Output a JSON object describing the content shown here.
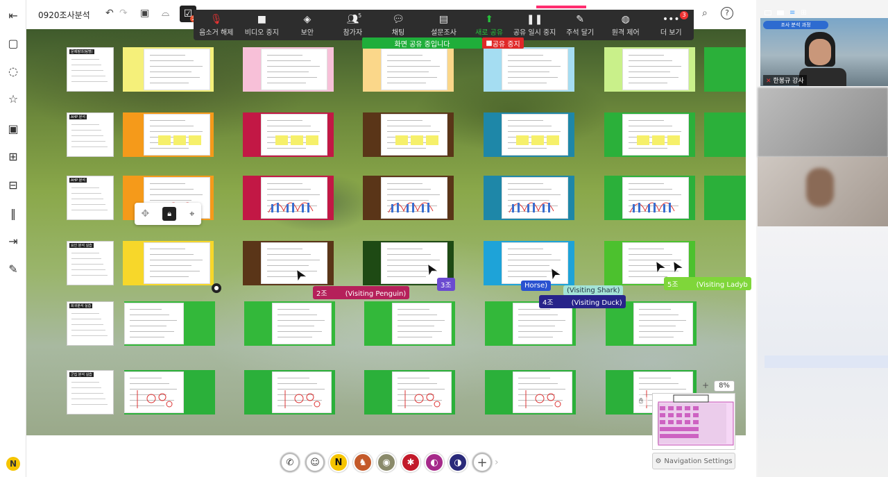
{
  "board": {
    "title": "0920조사분석",
    "badge": "2"
  },
  "zoom_toolbar": {
    "items": [
      {
        "label": "음소거 해제",
        "icon": "mic-off-icon"
      },
      {
        "label": "비디오 중지",
        "icon": "video-icon"
      },
      {
        "label": "보안",
        "icon": "shield-icon"
      },
      {
        "label": "참가자",
        "icon": "participants-icon",
        "count": "5"
      },
      {
        "label": "채팅",
        "icon": "chat-icon"
      },
      {
        "label": "설문조사",
        "icon": "poll-icon"
      },
      {
        "label": "새로 공유",
        "icon": "share-icon"
      },
      {
        "label": "공유 일시 중지",
        "icon": "pause-icon"
      },
      {
        "label": "주석 달기",
        "icon": "pen-icon"
      },
      {
        "label": "원격 제어",
        "icon": "mouse-icon"
      },
      {
        "label": "더 보기",
        "icon": "more-icon",
        "badge": "3"
      }
    ],
    "sharing_banner": "화면 공유 중입니다",
    "stop_share": "공유 중지"
  },
  "row_labels": [
    "문제정의(팀명)",
    "AHP 분석",
    "AHP 분석",
    "요인 분석 실습",
    "회귀분석 실습",
    "군집 분석 실습"
  ],
  "cursors": [
    {
      "label": "2조",
      "suffix": "(Visiting Penguin)",
      "color": "#b5205a"
    },
    {
      "label": "3조",
      "suffix": "",
      "color": "#6b4bd0"
    },
    {
      "label": "Horse)",
      "suffix": "",
      "color": "#2a52d0"
    },
    {
      "label": "(Visiting Shark)",
      "suffix": "",
      "color": "#a4e3d6"
    },
    {
      "label": "4조",
      "suffix": "(Visiting Duck)",
      "color": "#27238a"
    },
    {
      "label": "5조",
      "suffix": "(Visiting Ladyb",
      "color": "#7fd63a"
    }
  ],
  "zoom_level": "8%",
  "nav_settings": "Navigation Settings",
  "video": {
    "banner": "조사 분석 과정",
    "name": "한봉규 강사"
  },
  "colors": {
    "green_share": "#1fae3a",
    "red_stop": "#e02828",
    "toolbar_bg": "#2d2d2d"
  }
}
